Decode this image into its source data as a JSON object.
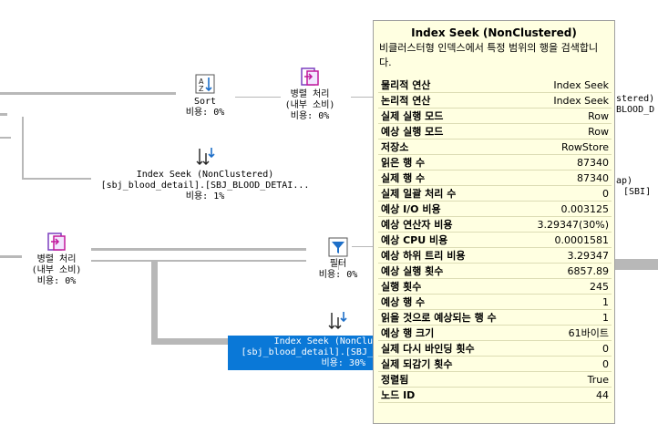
{
  "plan": {
    "nodes": {
      "sort": {
        "label": "Sort",
        "cost": "비용: 0%"
      },
      "parallelism_top": {
        "label1": "병렬 처리",
        "label2": "(내부 소비)",
        "cost": "비용: 0%"
      },
      "index_seek_mid": {
        "label1": "Index Seek (NonClustered)",
        "label2": "[sbj_blood_detail].[SBJ_BLOOD_DETAI...",
        "cost": "비용: 1%"
      },
      "parallelism_left": {
        "label1": "병렬 처리",
        "label2": "(내부 소비)",
        "cost": "비용: 0%"
      },
      "filter": {
        "label": "필터",
        "cost": "비용: 0%"
      },
      "index_seek_selected": {
        "label1": "Index Seek (NonClu",
        "label2": "[sbj_blood_detail].[SBJ_",
        "cost": "비용: 30%"
      }
    },
    "clipped_right": {
      "line1": "stered)",
      "line2": "BLOOD_D",
      "line3": "ap)",
      "line4": "[SBI]"
    }
  },
  "tooltip": {
    "title": "Index Seek (NonClustered)",
    "description": "비클러스터형 인덱스에서 특정 범위의 행을 검색합니다.",
    "rows": [
      {
        "key": "물리적 연산",
        "value": "Index Seek"
      },
      {
        "key": "논리적 연산",
        "value": "Index Seek"
      },
      {
        "key": "실제 실행 모드",
        "value": "Row"
      },
      {
        "key": "예상 실행 모드",
        "value": "Row"
      },
      {
        "key": "저장소",
        "value": "RowStore"
      },
      {
        "key": "읽은 행 수",
        "value": "87340"
      },
      {
        "key": "실제 행 수",
        "value": "87340"
      },
      {
        "key": "실제 일괄 처리 수",
        "value": "0"
      },
      {
        "key": "예상 I/O 비용",
        "value": "0.003125"
      },
      {
        "key": "예상 연산자 비용",
        "value": "3.29347(30%)"
      },
      {
        "key": "예상 CPU 비용",
        "value": "0.0001581"
      },
      {
        "key": "예상 하위 트리 비용",
        "value": "3.29347"
      },
      {
        "key": "예상 실행 횟수",
        "value": "6857.89"
      },
      {
        "key": "실행 횟수",
        "value": "245"
      },
      {
        "key": "예상 행 수",
        "value": "1"
      },
      {
        "key": "읽을 것으로 예상되는 행 수",
        "value": "1"
      },
      {
        "key": "예상 행 크기",
        "value": "61바이트"
      },
      {
        "key": "실제 다시 바인딩 횟수",
        "value": "0"
      },
      {
        "key": "실제 되감기 횟수",
        "value": "0"
      },
      {
        "key": "정렬됨",
        "value": "True"
      },
      {
        "key": "노드 ID",
        "value": "44"
      }
    ]
  },
  "colors": {
    "selection": "#0a78d7",
    "tooltip_bg": "#ffffe1",
    "connector": "#b8b8b8",
    "icon_purple": "#7b3fbf",
    "icon_magenta": "#c2189b",
    "icon_blue": "#1e6fc8"
  }
}
